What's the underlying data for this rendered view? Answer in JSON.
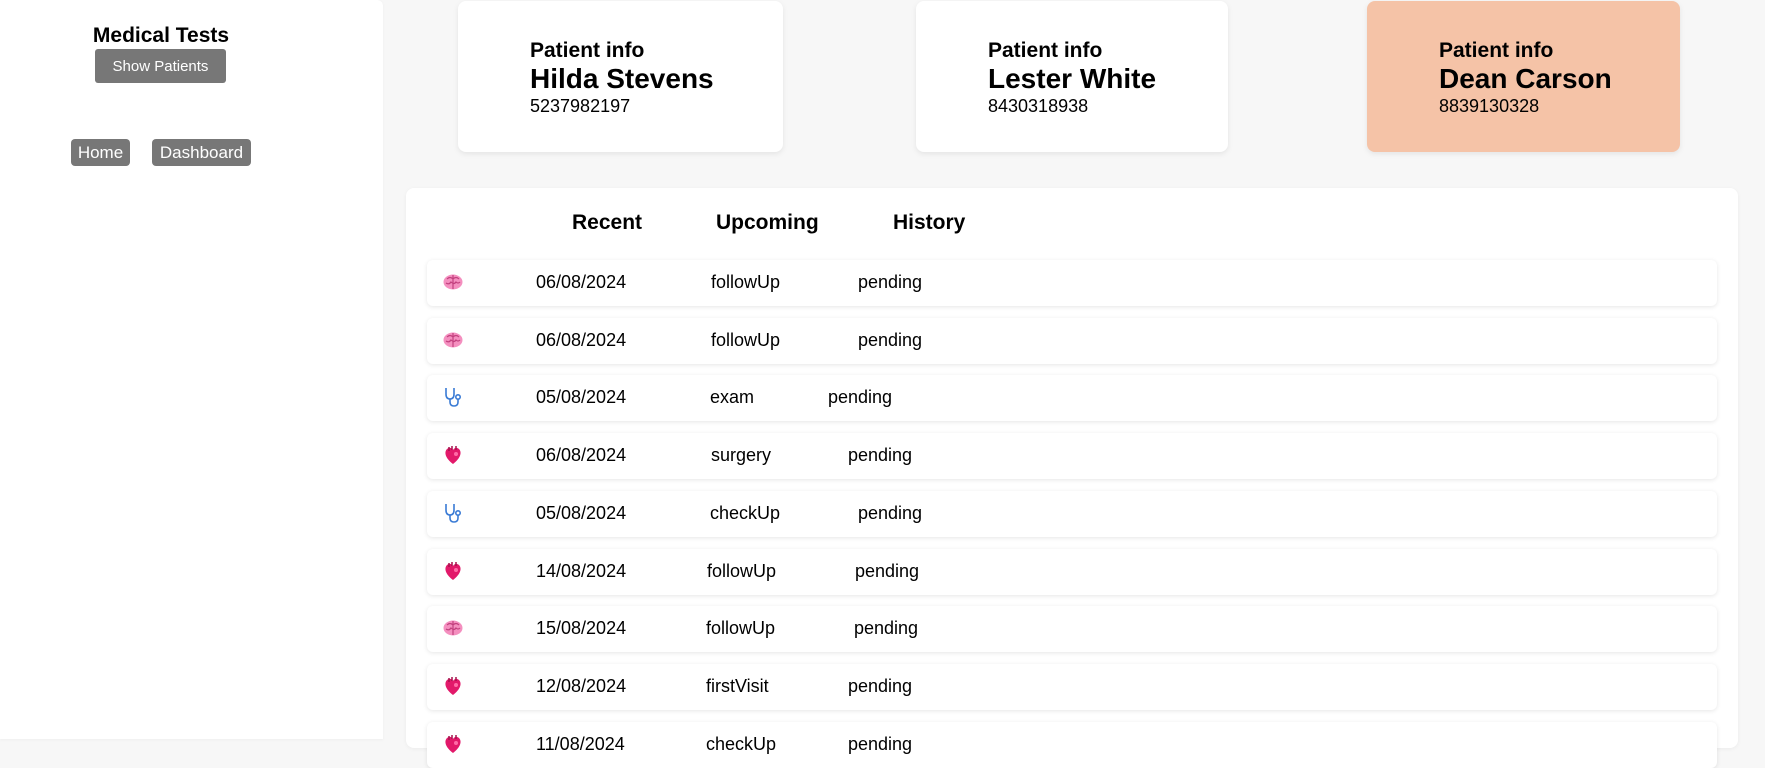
{
  "sidebar": {
    "title": "Medical Tests",
    "show_patients_label": "Show Patients",
    "nav": {
      "home": "Home",
      "dashboard": "Dashboard"
    }
  },
  "patients": [
    {
      "label": "Patient info",
      "name": "Hilda Stevens",
      "number": "5237982197",
      "selected": false
    },
    {
      "label": "Patient info",
      "name": "Lester White",
      "number": "8430318938",
      "selected": false
    },
    {
      "label": "Patient info",
      "name": "Dean Carson",
      "number": "8839130328",
      "selected": true
    }
  ],
  "tabs": {
    "recent": "Recent",
    "upcoming": "Upcoming",
    "history": "History"
  },
  "tests": [
    {
      "icon": "brain-icon",
      "date": "06/08/2024",
      "type": "followUp",
      "status": "pending"
    },
    {
      "icon": "brain-icon",
      "date": "06/08/2024",
      "type": "followUp",
      "status": "pending"
    },
    {
      "icon": "stethoscope-icon",
      "date": "05/08/2024",
      "type": "exam",
      "status": "pending"
    },
    {
      "icon": "heart-icon",
      "date": "06/08/2024",
      "type": "surgery",
      "status": "pending"
    },
    {
      "icon": "stethoscope-icon",
      "date": "05/08/2024",
      "type": "checkUp",
      "status": "pending"
    },
    {
      "icon": "heart-icon",
      "date": "14/08/2024",
      "type": "followUp",
      "status": "pending"
    },
    {
      "icon": "brain-icon",
      "date": "15/08/2024",
      "type": "followUp",
      "status": "pending"
    },
    {
      "icon": "heart-icon",
      "date": "12/08/2024",
      "type": "firstVisit",
      "status": "pending"
    },
    {
      "icon": "heart-icon",
      "date": "11/08/2024",
      "type": "checkUp",
      "status": "pending"
    }
  ],
  "colors": {
    "selected_card": "#f5c3a7",
    "button_gray": "#777777",
    "brain": "#f06aa8",
    "heart": "#e2196a",
    "stethoscope": "#3a7bd5"
  }
}
